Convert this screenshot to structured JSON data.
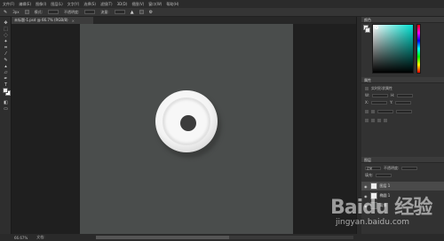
{
  "menubar": {
    "items": [
      "文件(F)",
      "编辑(E)",
      "图像(I)",
      "图层(L)",
      "文字(Y)",
      "选择(S)",
      "滤镜(T)",
      "3D(D)",
      "视图(V)",
      "窗口(W)",
      "帮助(H)"
    ]
  },
  "options": {
    "size_value": "3px",
    "mode_label": "模式:",
    "opacity_label": "不透明度:",
    "flow_label": "流量:"
  },
  "tab": {
    "title": "未标题-1.psd @ 66.7% (RGB/8)",
    "close": "×"
  },
  "status": {
    "zoom": "66.67%",
    "doc_info": "文档:"
  },
  "panels": {
    "color_title": "颜色",
    "properties_title": "属性",
    "shape_label": "实时形状属性",
    "w_label": "W:",
    "h_label": "H:",
    "x_label": "X:",
    "y_label": "Y:",
    "layers_title": "图层",
    "blend_mode": "正常",
    "opacity_label": "不透明度:",
    "fill_label": "填充:",
    "layers": [
      {
        "name": "图层 1"
      },
      {
        "name": "椭圆 1"
      },
      {
        "name": "背景"
      }
    ]
  },
  "watermark": {
    "logo": "Baidu 经验",
    "url": "jingyan.baidu.com"
  },
  "colors": {
    "canvas": "#4a4d4c",
    "panel": "#323232",
    "rim": "#f3f3f3",
    "dot": "#3c3c3c"
  }
}
